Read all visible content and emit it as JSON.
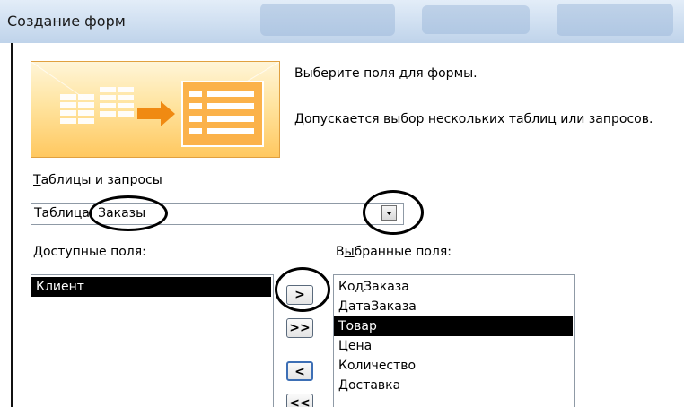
{
  "window": {
    "title": "Создание форм"
  },
  "intro": {
    "line1": "Выберите поля для формы.",
    "line2": "Допускается выбор нескольких таблиц или запросов."
  },
  "source": {
    "label_first": "Т",
    "label_rest": "аблицы и запросы",
    "value": "Таблица: Заказы",
    "dropdown_icon": "chevron-down-icon"
  },
  "available": {
    "label_first": "Д",
    "label_rest": "оступные поля:",
    "items": [
      {
        "label": "Клиент",
        "selected": true
      }
    ]
  },
  "selected": {
    "label_first": "В",
    "label_underlined": "ы",
    "label_rest": "бранные поля:",
    "items": [
      {
        "label": "КодЗаказа",
        "selected": false
      },
      {
        "label": "ДатаЗаказа",
        "selected": false
      },
      {
        "label": "Товар",
        "selected": true
      },
      {
        "label": "Цена",
        "selected": false
      },
      {
        "label": "Количество",
        "selected": false
      },
      {
        "label": "Доставка",
        "selected": false
      }
    ]
  },
  "buttons": {
    "add_one": ">",
    "add_all": ">>",
    "remove_one": "<",
    "remove_all": "<<"
  },
  "colors": {
    "selection_bg": "#000000",
    "banner_orange": "#f7a21b",
    "annotation": "#000000"
  }
}
